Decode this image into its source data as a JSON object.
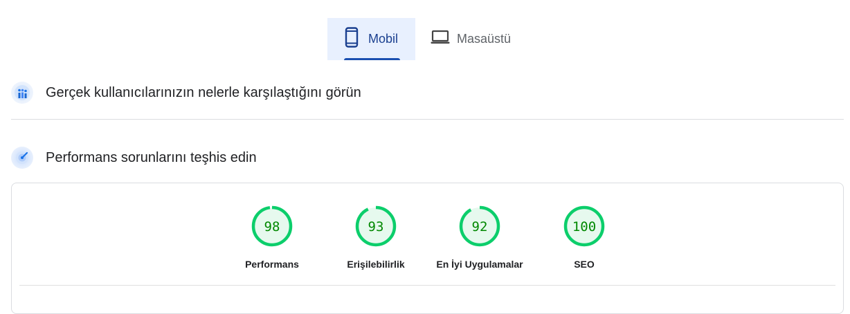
{
  "tabs": [
    {
      "label": "Mobil",
      "icon": "phone-icon",
      "active": true
    },
    {
      "label": "Masaüstü",
      "icon": "laptop-icon",
      "active": false
    }
  ],
  "sections": {
    "field_data": {
      "title": "Gerçek kullanıcılarınızın nelerle karşılaştığını görün",
      "icon": "field-data-icon"
    },
    "diagnose": {
      "title": "Performans sorunlarını teşhis edin",
      "icon": "lab-data-icon"
    }
  },
  "colors": {
    "accent": "#1a4fb0",
    "tab_active_bg": "#e8f0fe",
    "score_good": "#0cce6b",
    "score_good_bg": "#e6f9ee",
    "score_text": "#008800"
  },
  "scores": [
    {
      "name": "performance",
      "value": 98,
      "display": "98",
      "label": "Performans"
    },
    {
      "name": "accessibility",
      "value": 93,
      "display": "93",
      "label": "Erişilebilirlik"
    },
    {
      "name": "best-practices",
      "value": 92,
      "display": "92",
      "label": "En İyi Uygulamalar"
    },
    {
      "name": "seo",
      "value": 100,
      "display": "100",
      "label": "SEO"
    }
  ]
}
